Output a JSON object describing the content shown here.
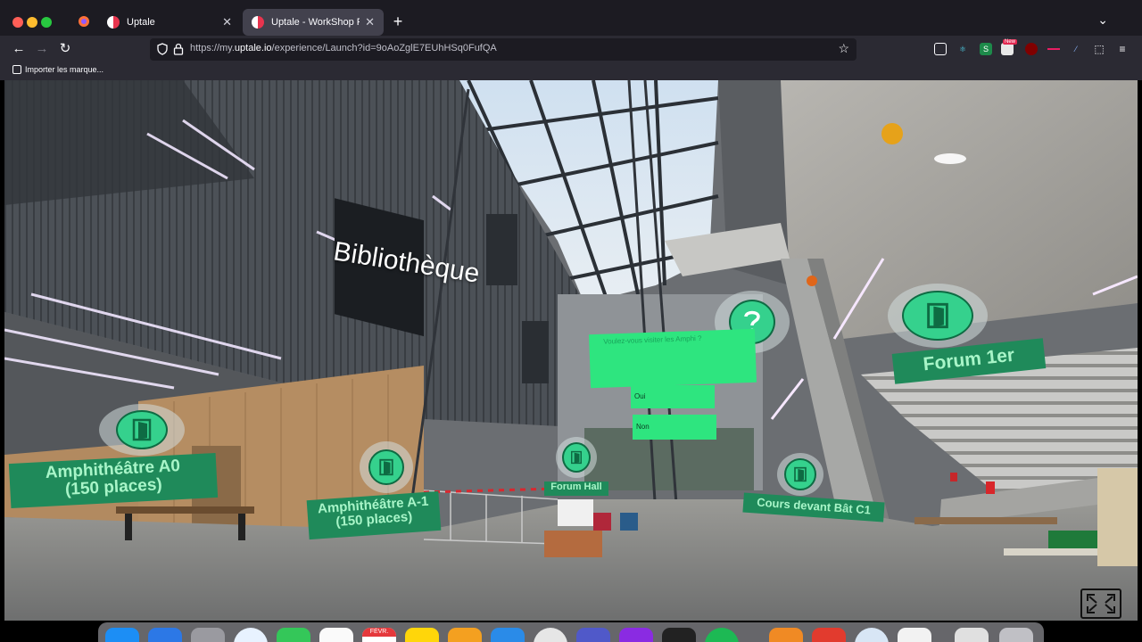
{
  "browser": {
    "tabs": [
      {
        "title": "Uptale",
        "active": false
      },
      {
        "title": "Uptale - WorkShop Paris-Saclay",
        "active": true
      }
    ],
    "url_prefix": "https://my.",
    "url_domain": "uptale.io",
    "url_path": "/experience/Launch?id=9oAoZglE7EUhHSq0FufQA",
    "bookmark_import_label": "Importer les marque...",
    "new_badge": "New"
  },
  "scene": {
    "labels": {
      "bibliotheque": "Bibliothèque",
      "quiz_question": "Voulez-vous visiter les Amphi ?",
      "quiz_yes": "Oui",
      "quiz_no": "Non"
    },
    "hotspots": [
      {
        "key": "amphi_a0",
        "line1": "Amphithéâtre A0",
        "line2": "(150 places)"
      },
      {
        "key": "amphi_a1",
        "line1": "Amphithéâtre A-1",
        "line2": "(150 places)"
      },
      {
        "key": "forum_hall",
        "line1": "Forum Hall",
        "line2": ""
      },
      {
        "key": "cours_c1",
        "line1": "Cours devant Bât C1",
        "line2": ""
      },
      {
        "key": "forum_1er",
        "line1": "Forum 1er",
        "line2": ""
      }
    ],
    "icons": {
      "door": "door-icon",
      "question": "question-icon"
    },
    "colors": {
      "hotspot_plate": "#1f8a5a",
      "hotspot_text": "#a8f5c8",
      "quiz_panel": "#2ee57f"
    }
  },
  "dock": {
    "calendar_month": "FÉVR."
  }
}
